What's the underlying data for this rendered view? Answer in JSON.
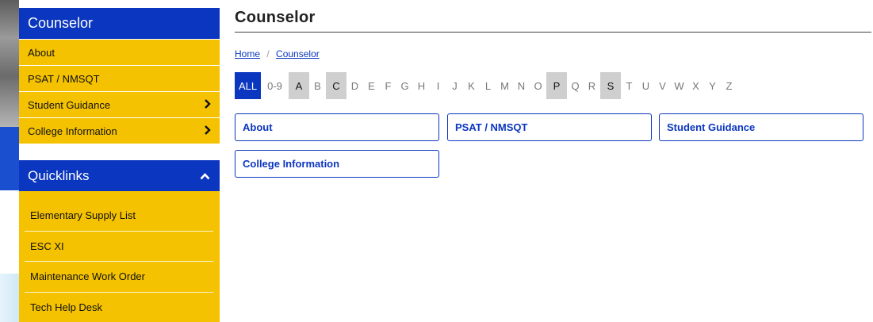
{
  "colors": {
    "primary_blue": "#0b36bf",
    "gold": "#f4c200",
    "active_letter_bg": "#cfcfcf"
  },
  "sidebar": {
    "title": "Counselor",
    "items": [
      {
        "label": "About",
        "has_submenu": false
      },
      {
        "label": "PSAT / NMSQT",
        "has_submenu": false
      },
      {
        "label": "Student Guidance",
        "has_submenu": true,
        "chevron": "›"
      },
      {
        "label": "College Information",
        "has_submenu": true,
        "chevron": "›"
      }
    ]
  },
  "quicklinks": {
    "title": "Quicklinks",
    "toggle_icon": "⌃",
    "items": [
      {
        "label": "Elementary Supply List"
      },
      {
        "label": "ESC XI"
      },
      {
        "label": "Maintenance Work Order"
      },
      {
        "label": "Tech Help Desk"
      }
    ]
  },
  "page": {
    "title": "Counselor",
    "breadcrumb": {
      "home": "Home",
      "separator": "/",
      "current": "Counselor"
    },
    "letters": {
      "all": "ALL",
      "range": "0-9",
      "items": [
        {
          "l": "A",
          "active": true
        },
        {
          "l": "B",
          "active": false
        },
        {
          "l": "C",
          "active": true
        },
        {
          "l": "D",
          "active": false
        },
        {
          "l": "E",
          "active": false
        },
        {
          "l": "F",
          "active": false
        },
        {
          "l": "G",
          "active": false
        },
        {
          "l": "H",
          "active": false
        },
        {
          "l": "I",
          "active": false
        },
        {
          "l": "J",
          "active": false
        },
        {
          "l": "K",
          "active": false
        },
        {
          "l": "L",
          "active": false
        },
        {
          "l": "M",
          "active": false
        },
        {
          "l": "N",
          "active": false
        },
        {
          "l": "O",
          "active": false
        },
        {
          "l": "P",
          "active": true
        },
        {
          "l": "Q",
          "active": false
        },
        {
          "l": "R",
          "active": false
        },
        {
          "l": "S",
          "active": true
        },
        {
          "l": "T",
          "active": false
        },
        {
          "l": "U",
          "active": false
        },
        {
          "l": "V",
          "active": false
        },
        {
          "l": "W",
          "active": false
        },
        {
          "l": "X",
          "active": false
        },
        {
          "l": "Y",
          "active": false
        },
        {
          "l": "Z",
          "active": false
        }
      ]
    },
    "cards": [
      {
        "label": "About"
      },
      {
        "label": "PSAT / NMSQT"
      },
      {
        "label": "Student Guidance"
      },
      {
        "label": "College Information"
      }
    ]
  }
}
